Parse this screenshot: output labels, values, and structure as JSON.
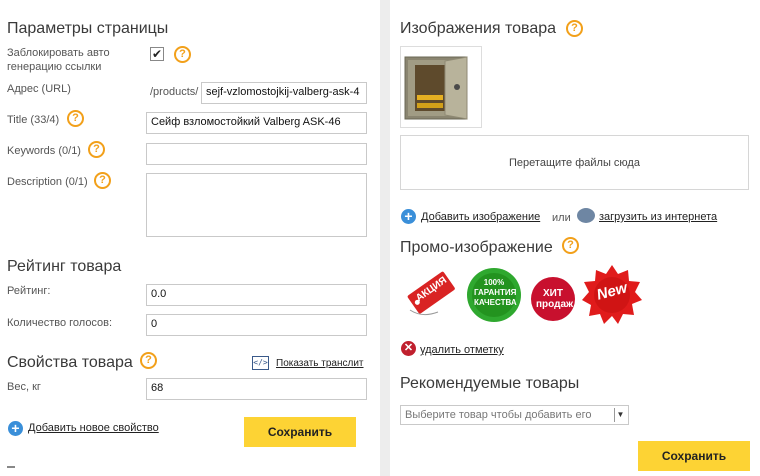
{
  "page_params": {
    "title": "Параметры страницы",
    "lock_label": "Заблокировать авто генерацию ссылки",
    "lock_checked": true,
    "url_label": "Адрес (URL)",
    "url_prefix": "/products/",
    "url_value": "sejf-vzlomostojkij-valberg-ask-4",
    "title_label": "Title (33/4)",
    "title_value": "Сейф взломостойкий Valberg ASK-46",
    "keywords_label": "Keywords (0/1)",
    "keywords_value": "",
    "description_label": "Description (0/1)",
    "description_value": ""
  },
  "rating": {
    "title": "Рейтинг товара",
    "rating_label": "Рейтинг:",
    "rating_value": "0.0",
    "votes_label": "Количество голосов:",
    "votes_value": "0"
  },
  "properties": {
    "title": "Свойства товара",
    "translit_link": "Показать транслит",
    "weight_label": "Вес, кг",
    "weight_value": "68",
    "add_property_link": "Добавить новое свойство",
    "save_label": "Сохранить"
  },
  "images": {
    "title": "Изображения товара",
    "dropzone_text": "Перетащите файлы сюда",
    "add_image_link": "Добавить изображение",
    "or_text": "или",
    "load_from_web_link": "загрузить из интернета"
  },
  "promo": {
    "title": "Промо-изображение",
    "badges": [
      {
        "text": "АКЦИЯ",
        "color": "#d92323"
      },
      {
        "text": "100% ГАРАНТИЯ КАЧЕСТВА",
        "color": "#2fa82f"
      },
      {
        "text": "ХИТ продаж",
        "color": "#c8102e"
      },
      {
        "text": "New",
        "color": "#e01b1b"
      }
    ],
    "remove_link": "удалить отметку"
  },
  "recommended": {
    "title": "Рекомендуемые товары",
    "select_placeholder": "Выберите товар чтобы добавить его",
    "save_label": "Сохранить"
  },
  "colors": {
    "accent": "#fdd334",
    "help": "#f2a01a",
    "link_icon": "#3a8fd9"
  }
}
